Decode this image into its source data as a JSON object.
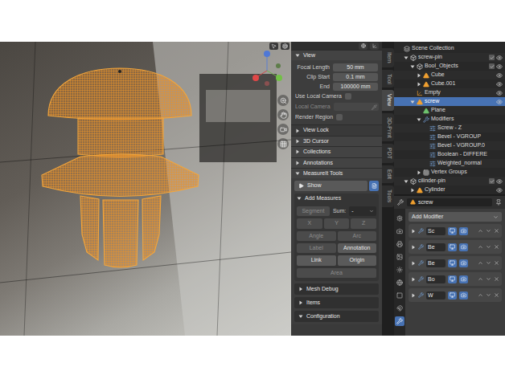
{
  "sidebar": {
    "tabs": [
      {
        "label": "Item",
        "selected": false
      },
      {
        "label": "Tool",
        "selected": false
      },
      {
        "label": "View",
        "selected": true
      },
      {
        "label": "3D-Print",
        "selected": false
      },
      {
        "label": "PDT",
        "selected": false
      },
      {
        "label": "Edit",
        "selected": false
      },
      {
        "label": "Tools",
        "selected": false
      }
    ],
    "view_panel": {
      "title": "View",
      "expanded": true,
      "fields": [
        {
          "label": "Focal Length",
          "value": "50 mm"
        },
        {
          "label": "Clip Start",
          "value": "0.1 mm"
        },
        {
          "label": "End",
          "value": "100000 mm"
        }
      ],
      "options": [
        {
          "kind": "checkbox",
          "label": "Use Local Camera",
          "checked": false,
          "disabled": false
        },
        {
          "kind": "picker",
          "label": "Local Camera",
          "checked": false,
          "disabled": true
        },
        {
          "kind": "checkbox",
          "label": "Render Region",
          "checked": false,
          "disabled": false
        }
      ],
      "subpanel": {
        "title": "View Lock",
        "expanded": false
      }
    },
    "panels": [
      {
        "title": "3D Cursor",
        "expanded": false
      },
      {
        "title": "Collections",
        "expanded": false
      },
      {
        "title": "Annotations",
        "expanded": false
      }
    ],
    "measureit": {
      "title": "MeasureIt Tools",
      "expanded": true,
      "show_button": "Show",
      "add_measures": {
        "title": "Add Measures",
        "expanded": true,
        "rows": [
          [
            {
              "kind": "button",
              "label": "Segment",
              "disabled": true
            },
            {
              "kind": "label",
              "label": "Sum:",
              "disabled": false
            },
            {
              "kind": "dropdown",
              "label": "-",
              "disabled": false
            }
          ],
          [
            {
              "kind": "button",
              "label": "X",
              "disabled": true
            },
            {
              "kind": "button",
              "label": "Y",
              "disabled": true
            },
            {
              "kind": "button",
              "label": "Z",
              "disabled": true
            }
          ],
          [
            {
              "kind": "button",
              "label": "Angle",
              "disabled": true
            },
            {
              "kind": "button",
              "label": "Arc",
              "disabled": true
            }
          ],
          [
            {
              "kind": "button",
              "label": "Label",
              "disabled": true
            },
            {
              "kind": "button",
              "label": "Annotation",
              "disabled": false
            }
          ],
          [
            {
              "kind": "button",
              "label": "Link",
              "disabled": false
            },
            {
              "kind": "button",
              "label": "Origin",
              "disabled": false
            }
          ],
          [
            {
              "kind": "button",
              "label": "Area",
              "disabled": true
            }
          ]
        ]
      },
      "subpanels": [
        {
          "title": "Mesh Debug",
          "expanded": false
        },
        {
          "title": "Items",
          "expanded": false
        },
        {
          "title": "Configuration",
          "expanded": true
        }
      ]
    }
  },
  "outliner": {
    "items": [
      {
        "label": "Scene Collection",
        "depth": 0,
        "kind": "scene",
        "expandable": false,
        "expanded": false,
        "selected": false
      },
      {
        "label": "screw-pin",
        "depth": 1,
        "kind": "collection",
        "expandable": true,
        "expanded": true,
        "selected": false,
        "checked": true,
        "visible": true
      },
      {
        "label": "Bool_Objects",
        "depth": 2,
        "kind": "collection",
        "expandable": true,
        "expanded": true,
        "selected": false,
        "checked": true,
        "visible": true
      },
      {
        "label": "Cube",
        "depth": 3,
        "kind": "mesh",
        "expandable": true,
        "expanded": false,
        "selected": false,
        "visible": true
      },
      {
        "label": "Cube.001",
        "depth": 3,
        "kind": "mesh",
        "expandable": true,
        "expanded": false,
        "selected": false,
        "visible": true
      },
      {
        "label": "Empty",
        "depth": 2,
        "kind": "empty",
        "expandable": false,
        "expanded": false,
        "selected": false,
        "visible": true
      },
      {
        "label": "screw",
        "depth": 2,
        "kind": "mesh",
        "expandable": true,
        "expanded": true,
        "selected": true,
        "visible": true
      },
      {
        "label": "Plane",
        "depth": 3,
        "kind": "data",
        "expandable": false,
        "expanded": false,
        "selected": false
      },
      {
        "label": "Modifiers",
        "depth": 3,
        "kind": "wrench",
        "expandable": true,
        "expanded": true,
        "selected": false
      },
      {
        "label": "Screw - Z",
        "depth": 4,
        "kind": "modifier",
        "expandable": false,
        "expanded": false,
        "selected": false
      },
      {
        "label": "Bevel - VGROUP",
        "depth": 4,
        "kind": "modifier",
        "expandable": false,
        "expanded": false,
        "selected": false
      },
      {
        "label": "Bevel - VGROUP.0",
        "depth": 4,
        "kind": "modifier",
        "expandable": false,
        "expanded": false,
        "selected": false
      },
      {
        "label": "Boolean - DIFFERE",
        "depth": 4,
        "kind": "modifier",
        "expandable": false,
        "expanded": false,
        "selected": false
      },
      {
        "label": "Weighted_normal",
        "depth": 4,
        "kind": "modifier",
        "expandable": false,
        "expanded": false,
        "selected": false
      },
      {
        "label": "Vertex Groups",
        "depth": 3,
        "kind": "vgroup",
        "expandable": true,
        "expanded": false,
        "selected": false
      },
      {
        "label": "cilinder-pin",
        "depth": 1,
        "kind": "collection",
        "expandable": true,
        "expanded": true,
        "selected": false,
        "checked": true,
        "visible": true
      },
      {
        "label": "Cylinder",
        "depth": 2,
        "kind": "mesh",
        "expandable": true,
        "expanded": false,
        "selected": false,
        "visible": true
      }
    ]
  },
  "properties": {
    "object_name": "screw",
    "add_modifier": "Add Modifier",
    "tabs": [
      {
        "selected": false
      },
      {
        "selected": false
      },
      {
        "selected": false
      },
      {
        "selected": false
      },
      {
        "selected": false
      },
      {
        "selected": false
      },
      {
        "selected": false
      },
      {
        "selected": false
      },
      {
        "selected": true
      }
    ],
    "modifiers": [
      {
        "name": "Sc",
        "expanded": false,
        "show_viewport": true,
        "show_render": true
      },
      {
        "name": "Be",
        "expanded": false,
        "show_viewport": true,
        "show_render": true
      },
      {
        "name": "Be",
        "expanded": false,
        "show_viewport": true,
        "show_render": true
      },
      {
        "name": "Bo",
        "expanded": false,
        "show_viewport": true,
        "show_render": true
      },
      {
        "name": "W",
        "expanded": false,
        "show_viewport": true,
        "show_render": true
      }
    ]
  }
}
